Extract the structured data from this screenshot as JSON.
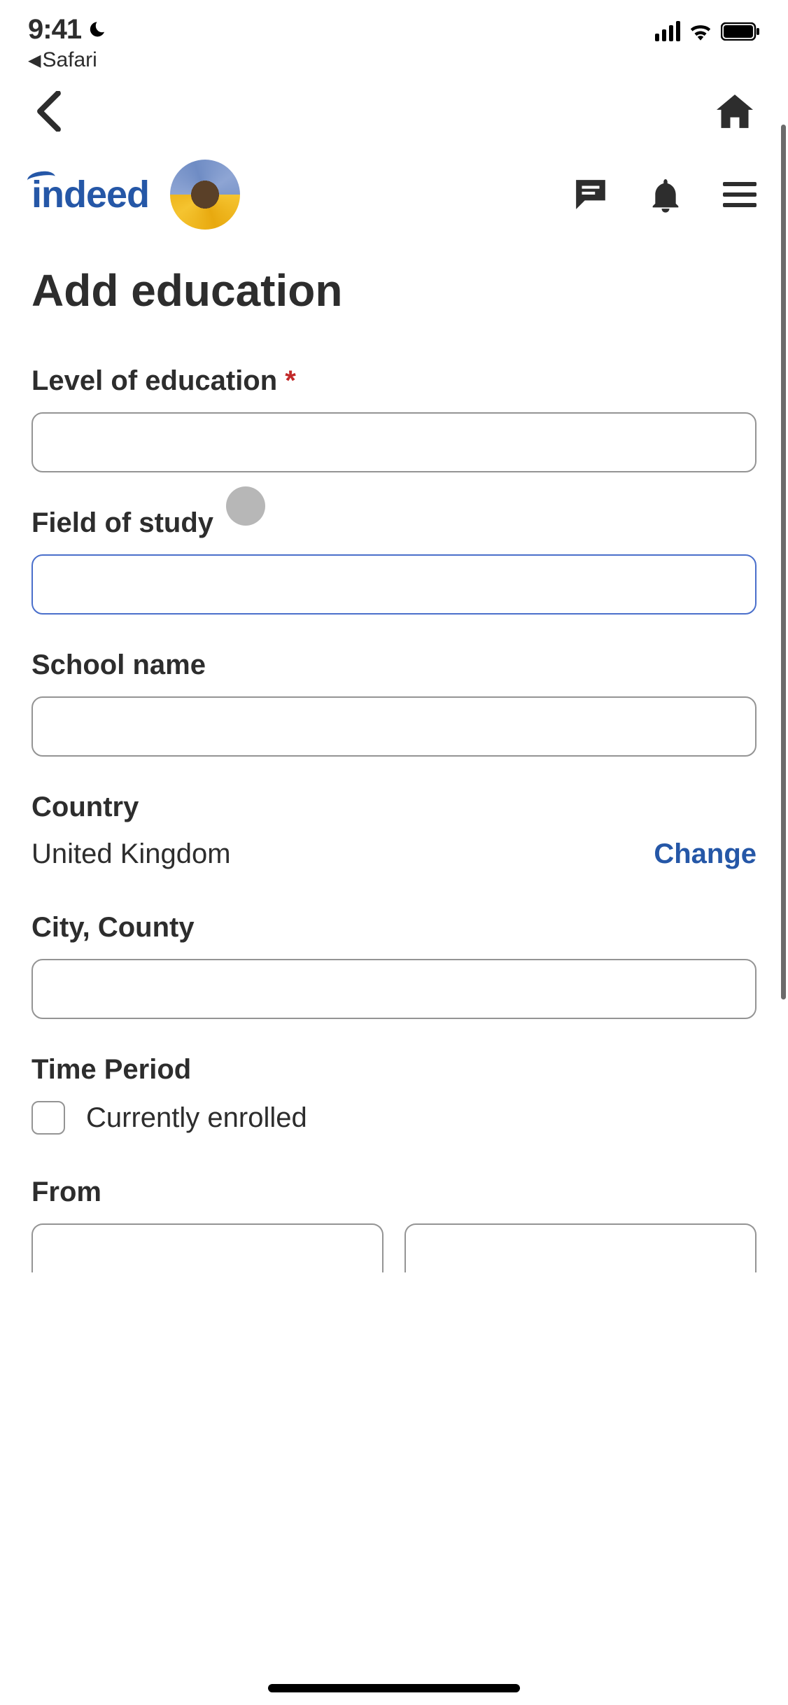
{
  "status": {
    "time": "9:41",
    "back_app": "Safari"
  },
  "brand": {
    "logo_text": "indeed"
  },
  "page": {
    "title": "Add education"
  },
  "form": {
    "level_label": "Level of education",
    "level_value": "",
    "field_label": "Field of study",
    "field_value": "",
    "school_label": "School name",
    "school_value": "",
    "country_label": "Country",
    "country_value": "United Kingdom",
    "change_label": "Change",
    "city_label": "City, County",
    "city_value": "",
    "time_period_label": "Time Period",
    "enrolled_label": "Currently enrolled",
    "from_label": "From"
  }
}
